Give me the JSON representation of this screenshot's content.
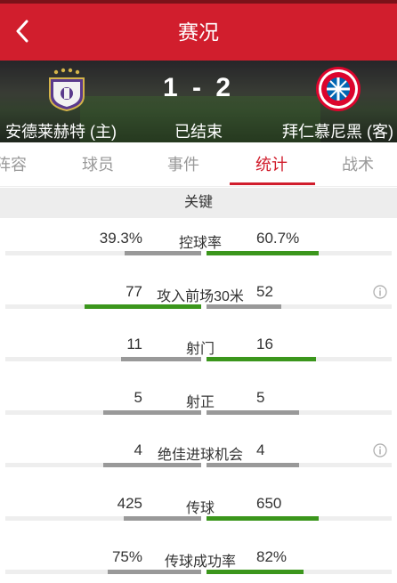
{
  "header": {
    "title": "赛况"
  },
  "match": {
    "home_team": "安德莱赫特 (主)",
    "away_team": "拜仁慕尼黑 (客)",
    "score": "1 - 2",
    "status": "已结束"
  },
  "tabs": [
    {
      "label": "阵容",
      "active": false
    },
    {
      "label": "球员",
      "active": false
    },
    {
      "label": "事件",
      "active": false
    },
    {
      "label": "统计",
      "active": true
    },
    {
      "label": "战术",
      "active": false
    }
  ],
  "section": {
    "title": "关键"
  },
  "colors": {
    "accent": "#d11e2d",
    "leader_bar": "#3b961c",
    "trailer_bar": "#999999"
  },
  "stats": [
    {
      "label": "控球率",
      "home": "39.3%",
      "away": "60.7%",
      "home_share": 0.393,
      "away_share": 0.607,
      "leader": "away",
      "info": false
    },
    {
      "label": "攻入前场30米",
      "home": "77",
      "away": "52",
      "home_share": 0.597,
      "away_share": 0.403,
      "leader": "home",
      "info": true
    },
    {
      "label": "射门",
      "home": "11",
      "away": "16",
      "home_share": 0.407,
      "away_share": 0.593,
      "leader": "away",
      "info": false
    },
    {
      "label": "射正",
      "home": "5",
      "away": "5",
      "home_share": 0.5,
      "away_share": 0.5,
      "leader": "none",
      "info": false
    },
    {
      "label": "绝佳进球机会",
      "home": "4",
      "away": "4",
      "home_share": 0.5,
      "away_share": 0.5,
      "leader": "none",
      "info": true
    },
    {
      "label": "传球",
      "home": "425",
      "away": "650",
      "home_share": 0.395,
      "away_share": 0.605,
      "leader": "away",
      "info": false
    },
    {
      "label": "传球成功率",
      "home": "75%",
      "away": "82%",
      "home_share": 0.478,
      "away_share": 0.522,
      "leader": "away",
      "info": false
    }
  ]
}
